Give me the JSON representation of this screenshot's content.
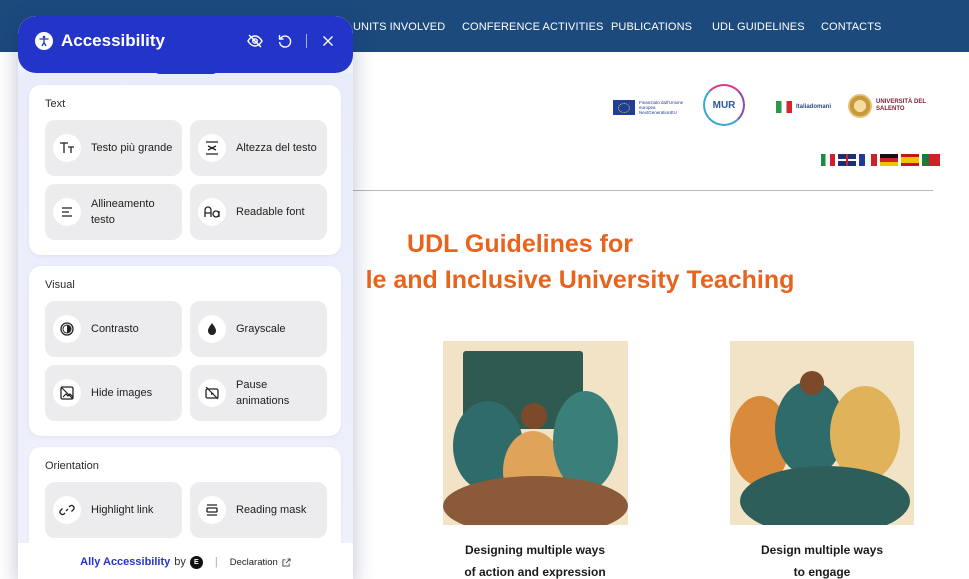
{
  "site": {
    "nav": [
      {
        "id": "units",
        "label": "UNITS INVOLVED"
      },
      {
        "id": "conference",
        "label": "CONFERENCE ACTIVITIES"
      },
      {
        "id": "publications",
        "label": "PUBLICATIONS"
      },
      {
        "id": "udl",
        "label": "UDL GUIDELINES"
      },
      {
        "id": "contacts",
        "label": "CONTACTS"
      }
    ],
    "logos": {
      "eu_text": "Finanziato dall'Unione europea NextGenerationEU",
      "mur_text": "MUR",
      "italia_text": "Italiadomani",
      "unisalento_text": "UNIVERSITÀ DEL SALENTO"
    },
    "hero": {
      "line1": "UDL Guidelines for",
      "line2": "le and Inclusive University Teaching"
    },
    "cards": [
      {
        "caption_line1": "Designing multiple ways",
        "caption_line2": "of action and expression"
      },
      {
        "caption_line1": "Design multiple ways",
        "caption_line2": "to engage"
      }
    ],
    "colors": {
      "nav_bg": "#1c4a7d",
      "hero_orange": "#e8631e",
      "illustration_bg": "#f3e3c6"
    }
  },
  "a11y": {
    "title": "Accessibility",
    "accent": "#2334c8",
    "sections": {
      "text": {
        "label": "Text",
        "tiles": [
          {
            "label": "Testo più grande",
            "icon": "text-size-icon"
          },
          {
            "label": "Altezza del testo",
            "icon": "line-height-icon"
          },
          {
            "label": "Allineamento testo",
            "icon": "align-icon"
          },
          {
            "label": "Readable font",
            "icon": "font-icon"
          }
        ]
      },
      "visual": {
        "label": "Visual",
        "tiles": [
          {
            "label": "Contrasto",
            "icon": "contrast-icon"
          },
          {
            "label": "Grayscale",
            "icon": "grayscale-icon"
          },
          {
            "label": "Hide images",
            "icon": "hide-image-icon"
          },
          {
            "label": "Pause animations",
            "icon": "pause-animation-icon"
          }
        ]
      },
      "orientation": {
        "label": "Orientation",
        "tiles": [
          {
            "label": "Highlight link",
            "icon": "link-icon"
          },
          {
            "label": "Reading mask",
            "icon": "reading-mask-icon"
          }
        ]
      }
    },
    "footer": {
      "brand": "Ally Accessibility",
      "by": "by",
      "badge": "E",
      "separator": "|",
      "declaration": "Declaration"
    }
  }
}
